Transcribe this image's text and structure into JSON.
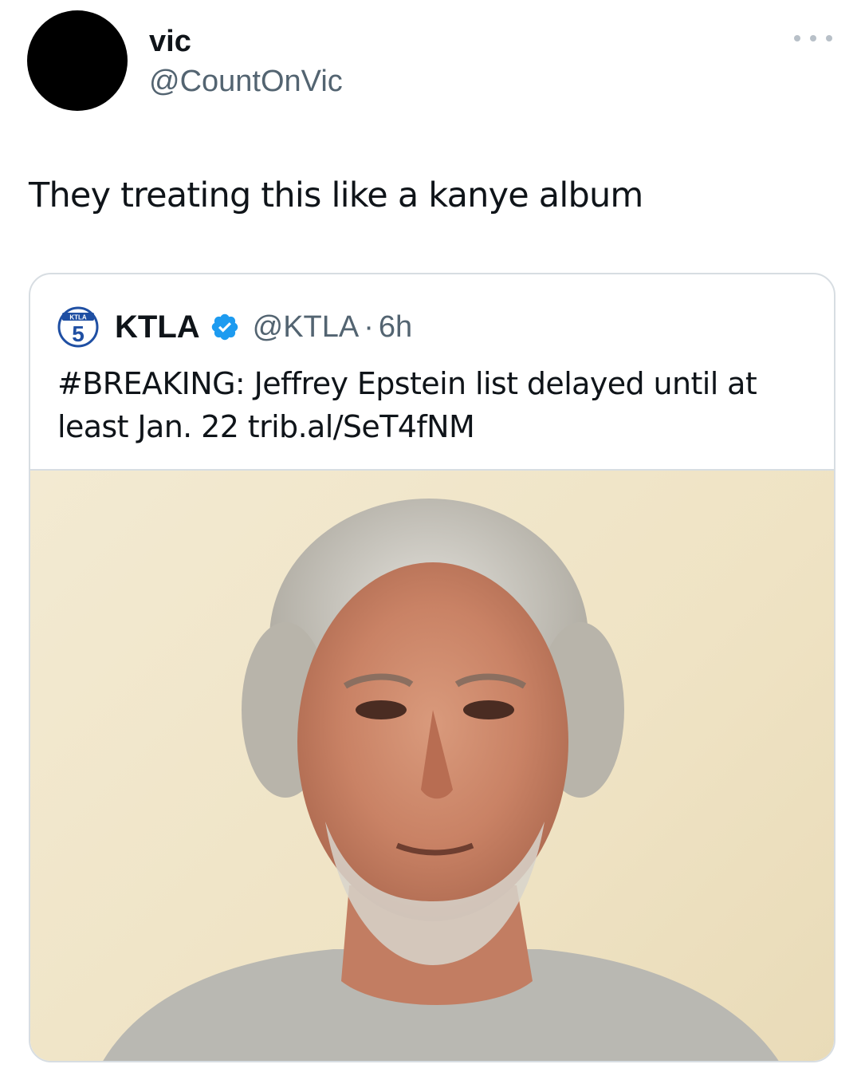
{
  "author": {
    "display_name": "vic",
    "handle": "@CountOnVic",
    "avatar_color": "#000000"
  },
  "tweet": {
    "text": "They treating this like a kanye album"
  },
  "menu": {
    "icon": "more-horizontal-icon"
  },
  "quoted_tweet": {
    "logo_icon": "ktla-5-logo",
    "logo_text_top": "KTLA",
    "logo_text_number": "5",
    "display_name": "KTLA",
    "verified_icon": "verified-badge-icon",
    "handle": "@KTLA",
    "separator": "·",
    "time": "6h",
    "text": "#BREAKING: Jeffrey Epstein list delayed until at least Jan. 22 trib.al/SeT4fNM",
    "image_description_icon": "photo-portrait"
  },
  "colors": {
    "text_primary": "#0f1419",
    "text_secondary": "#536471",
    "border": "#d7dde2",
    "verified_blue": "#1d9bf0",
    "ktla_blue": "#1f4fa3"
  }
}
